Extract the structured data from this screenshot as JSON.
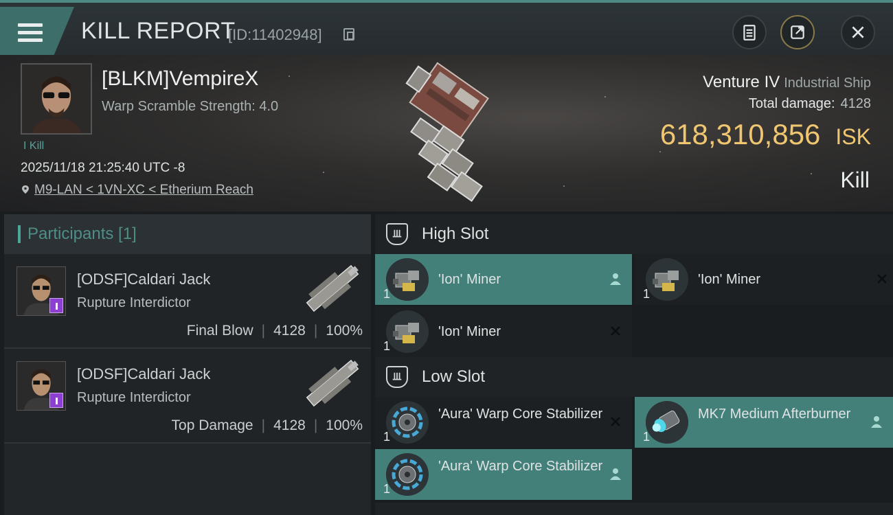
{
  "header": {
    "title": "KILL REPORT",
    "report_id": "[ID:11402948]"
  },
  "victim": {
    "name": "[BLKM]VempireX",
    "scramble": "Warp Scramble Strength: 4.0",
    "kill_tag": "I Kill",
    "timestamp": "2025/11/18 21:25:40 UTC -8",
    "location": "M9-LAN < 1VN-XC < Etherium Reach",
    "ship_name": "Venture IV",
    "ship_class": "Industrial Ship",
    "damage_label": "Total damage:",
    "damage_value": "4128",
    "isk_value": "618,310,856",
    "isk_unit": "ISK",
    "result": "Kill"
  },
  "participants": {
    "label": "Participants [1]",
    "rows": [
      {
        "name": "[ODSF]Caldari Jack",
        "ship": "Rupture Interdictor",
        "role": "Final Blow",
        "damage": "4128",
        "percent": "100%"
      },
      {
        "name": "[ODSF]Caldari Jack",
        "ship": "Rupture Interdictor",
        "role": "Top Damage",
        "damage": "4128",
        "percent": "100%"
      }
    ]
  },
  "slots": {
    "high": {
      "label": "High Slot",
      "modules": [
        {
          "qty": "1",
          "name": "'Ion' Miner",
          "status": "dropped"
        },
        {
          "qty": "1",
          "name": "'Ion' Miner",
          "status": "destroyed"
        },
        {
          "qty": "1",
          "name": "'Ion' Miner",
          "status": "destroyed"
        }
      ]
    },
    "low": {
      "label": "Low Slot",
      "modules": [
        {
          "qty": "1",
          "name": "'Aura' Warp Core Stabilizer",
          "status": "destroyed"
        },
        {
          "qty": "1",
          "name": "MK7 Medium Afterburner",
          "status": "dropped"
        },
        {
          "qty": "1",
          "name": "'Aura' Warp Core Stabilizer",
          "status": "dropped"
        }
      ]
    }
  },
  "colors": {
    "accent": "#43807a",
    "isk": "#f0c770",
    "purple_badge": "#8c3fd0"
  },
  "icons": [
    "menu-icon",
    "copy-icon",
    "clipboard-icon",
    "share-icon",
    "close-icon",
    "location-pin-icon",
    "high-slot-icon",
    "low-slot-icon",
    "person-icon",
    "x-icon"
  ]
}
